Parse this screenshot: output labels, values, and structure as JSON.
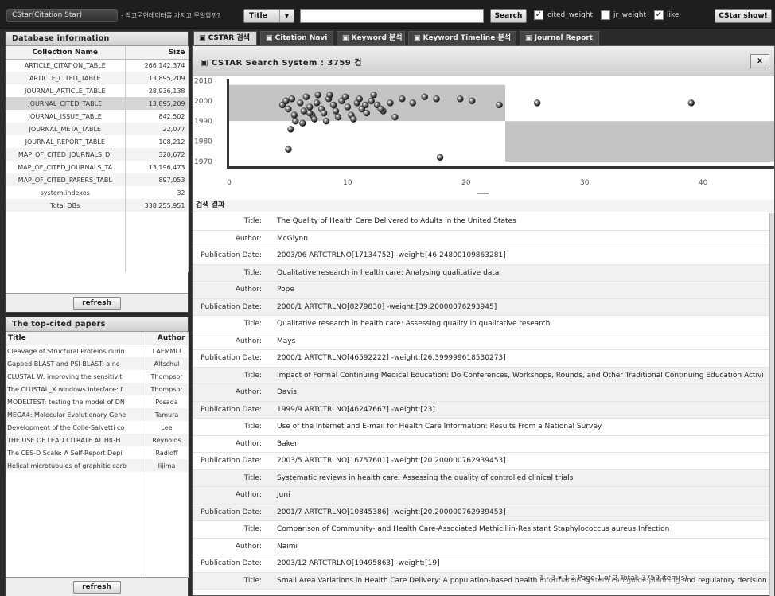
{
  "topbar": {
    "app_title": "CStar(Citation Star)",
    "subtitle": "- 참고문헌데이터를 가지고 무얼할까?",
    "search_field": "Title",
    "search_value": "",
    "search_label": "Search",
    "cited_weight_label": "cited_weight",
    "cited_weight_checked": "✓",
    "jr_weight_label": "jr_weight",
    "like_label": "like",
    "like_checked": "✓",
    "cstar_show_label": "CStar show!"
  },
  "database_panel": {
    "title": "Database information",
    "col_name": "Collection Name",
    "col_size": "Size",
    "rows": [
      {
        "name": "ARTICLE_CITATION_TABLE",
        "size": "266,142,374"
      },
      {
        "name": "ARTICLE_CITED_TABLE",
        "size": "13,895,209"
      },
      {
        "name": "JOURNAL_ARTICLE_TABLE",
        "size": "28,936,138"
      },
      {
        "name": "JOURNAL_CITED_TABLE",
        "size": "13,895,209"
      },
      {
        "name": "JOURNAL_ISSUE_TABLE",
        "size": "842,502"
      },
      {
        "name": "JOURNAL_META_TABLE",
        "size": "22,077"
      },
      {
        "name": "JOURNAL_REPORT_TABLE",
        "size": "108,212"
      },
      {
        "name": "MAP_OF_CITED_JOURNALS_DI",
        "size": "320,672"
      },
      {
        "name": "MAP_OF_CITED_JOURNALS_TA",
        "size": "13,196,473"
      },
      {
        "name": "MAP_OF_CITED_PAPERS_TABL",
        "size": "897,053"
      },
      {
        "name": "system.indexes",
        "size": "32"
      },
      {
        "name": "Total DBs",
        "size": "338,255,951"
      }
    ],
    "refresh_label": "refresh"
  },
  "topcited_panel": {
    "title": "The top-cited papers",
    "col_title": "Title",
    "col_author": "Author",
    "rows": [
      {
        "title": "Cleavage of Structural Proteins durin",
        "author": "LAEMMLI"
      },
      {
        "title": "Gapped BLAST and PSI-BLAST: a ne",
        "author": "Altschul"
      },
      {
        "title": "CLUSTAL W: improving the sensitivit",
        "author": "Thompsor"
      },
      {
        "title": "The CLUSTAL_X windows interface: f",
        "author": "Thompsor"
      },
      {
        "title": "MODELTEST: testing the model of DN",
        "author": "Posada"
      },
      {
        "title": "MEGA4: Molecular Evolutionary Gene",
        "author": "Tamura"
      },
      {
        "title": "Development of the Colle-Salvetti co",
        "author": "Lee"
      },
      {
        "title": "THE USE OF LEAD CITRATE AT HIGH",
        "author": "Reynolds"
      },
      {
        "title": "The CES-D Scale: A Self-Report Depi",
        "author": "Radloff"
      },
      {
        "title": "Helical microtubules of graphitic carb",
        "author": "Iijima"
      }
    ],
    "refresh_label": "refresh"
  },
  "tabs": [
    {
      "label": "▣ CSTAR 검색"
    },
    {
      "label": "▣ Citation Navi"
    },
    {
      "label": "▣ Keyword 분석"
    },
    {
      "label": "▣ Keyword Timeline 분석"
    },
    {
      "label": "▣ Journal Report"
    }
  ],
  "search_system": {
    "title": "▣ CSTAR Search System :  3759 건",
    "close_label": "x"
  },
  "chart_data": {
    "type": "scatter",
    "x_ticks": [
      "0",
      "10",
      "20",
      "30",
      "40"
    ],
    "y_ticks": [
      "2010",
      "2000",
      "1990",
      "1980",
      "1970"
    ],
    "xlim": [
      0,
      46
    ],
    "ylim": [
      1968,
      2011
    ],
    "points": [
      [
        4.5,
        1998
      ],
      [
        5,
        1996
      ],
      [
        5.5,
        1993
      ],
      [
        6,
        1999
      ],
      [
        6.3,
        1995
      ],
      [
        6.8,
        1997
      ],
      [
        7,
        1993
      ],
      [
        7.4,
        1999
      ],
      [
        7.8,
        1996
      ],
      [
        8,
        1994
      ],
      [
        8.4,
        2001
      ],
      [
        8.8,
        1998
      ],
      [
        9,
        1995
      ],
      [
        9.5,
        2000
      ],
      [
        10,
        1997
      ],
      [
        10.3,
        1993
      ],
      [
        10.8,
        1999
      ],
      [
        11.2,
        1996
      ],
      [
        11.6,
        1994
      ],
      [
        12,
        2000
      ],
      [
        12.5,
        1998
      ],
      [
        13,
        1995
      ],
      [
        4.8,
        2000
      ],
      [
        5.3,
        2001
      ],
      [
        6.5,
        2002
      ],
      [
        7.5,
        2003
      ],
      [
        8.5,
        2003
      ],
      [
        9.8,
        2002
      ],
      [
        11,
        2001
      ],
      [
        12.2,
        2003
      ],
      [
        5.6,
        1990
      ],
      [
        6.2,
        1989
      ],
      [
        7.2,
        1991
      ],
      [
        8.2,
        1990
      ],
      [
        10.5,
        1991
      ],
      [
        14,
        1992
      ],
      [
        14.6,
        2001
      ],
      [
        15.5,
        1999
      ],
      [
        16.5,
        2002
      ],
      [
        17.5,
        2001
      ],
      [
        19.5,
        2001
      ],
      [
        20.5,
        2000
      ],
      [
        22.8,
        1998
      ],
      [
        26,
        1999
      ],
      [
        39,
        1999
      ],
      [
        13.6,
        1999
      ],
      [
        5.2,
        1986
      ],
      [
        5,
        1976
      ],
      [
        17.8,
        1972
      ],
      [
        11.5,
        1998
      ],
      [
        6.8,
        1994
      ],
      [
        9.2,
        1992
      ],
      [
        12.8,
        1996
      ]
    ]
  },
  "results": {
    "header": "검색 결과",
    "rows": [
      {
        "label": "Title:",
        "value": "The Quality of Health Care Delivered to Adults in the United States"
      },
      {
        "label": "Author:",
        "value": "McGlynn"
      },
      {
        "label": "Publication Date:",
        "value": "2003/06 ARTCTRLNO[17134752] -weight:[46.24800109863281]"
      },
      {
        "label": "Title:",
        "value": "Qualitative research in health care: Analysing qualitative data"
      },
      {
        "label": "Author:",
        "value": "Pope"
      },
      {
        "label": "Publication Date:",
        "value": "2000/1 ARTCTRLNO[8279830] -weight:[39.20000076293945]"
      },
      {
        "label": "Title:",
        "value": "Qualitative research in health care: Assessing quality in qualitative research"
      },
      {
        "label": "Author:",
        "value": "Mays"
      },
      {
        "label": "Publication Date:",
        "value": "2000/1 ARTCTRLNO[46592222] -weight:[26.399999618530273]"
      },
      {
        "label": "Title:",
        "value": "Impact of Formal Continuing Medical Education: Do Conferences, Workshops, Rounds, and Other Traditional Continuing Education Activi"
      },
      {
        "label": "Author:",
        "value": "Davis"
      },
      {
        "label": "Publication Date:",
        "value": "1999/9 ARTCTRLNO[46247667] -weight:[23]"
      },
      {
        "label": "Title:",
        "value": "Use of the Internet and E-mail for Health Care Information: Results From a National Survey"
      },
      {
        "label": "Author:",
        "value": "Baker"
      },
      {
        "label": "Publication Date:",
        "value": "2003/5 ARTCTRLNO[16757601] -weight:[20.200000762939453]"
      },
      {
        "label": "Title:",
        "value": "Systematic reviews in health care: Assessing the quality of controlled clinical trials"
      },
      {
        "label": "Author:",
        "value": "Juni"
      },
      {
        "label": "Publication Date:",
        "value": "2001/7 ARTCTRLNO[10845386] -weight:[20.200000762939453]"
      },
      {
        "label": "Title:",
        "value": "Comparison of Community- and Health Care-Associated Methicillin-Resistant Staphylococcus aureus Infection"
      },
      {
        "label": "Author:",
        "value": "Naimi"
      },
      {
        "label": "Publication Date:",
        "value": "2003/12 ARTCTRLNO[19495863] -weight:[19]"
      },
      {
        "label": "Title:",
        "value": "Small Area Variations in Health Care Delivery: A population-based health information system can guide planning and regulatory decision"
      }
    ],
    "pager": "1 - 3  ▾   1  2  Page 1 of 2  Total: 3759 item(s)"
  }
}
